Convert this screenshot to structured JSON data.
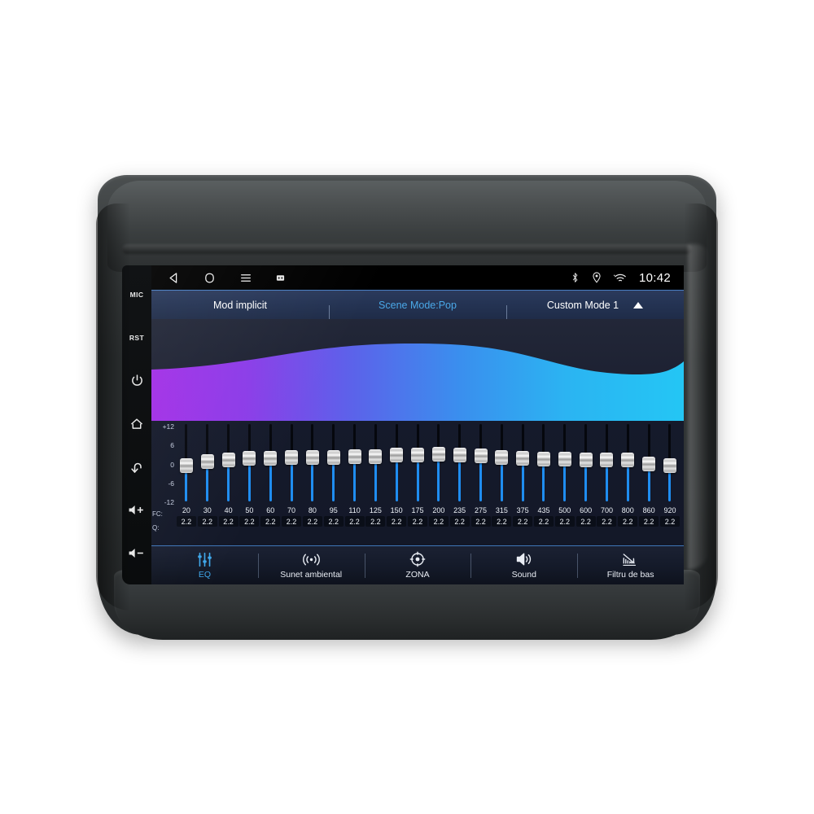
{
  "device": {
    "hardware_keys": [
      {
        "name": "mic",
        "label": "MIC",
        "icon": "mic-text"
      },
      {
        "name": "reset",
        "label": "RST",
        "icon": "reset-text"
      },
      {
        "name": "power",
        "label": "",
        "icon": "power-icon"
      },
      {
        "name": "home",
        "label": "",
        "icon": "home-icon"
      },
      {
        "name": "back",
        "label": "",
        "icon": "back-arrow-icon"
      },
      {
        "name": "volume-up",
        "label": "",
        "icon": "volume-up-icon"
      },
      {
        "name": "volume-down",
        "label": "",
        "icon": "volume-down-icon"
      }
    ]
  },
  "statusbar": {
    "nav": [
      "back-icon",
      "home-icon",
      "menu-icon",
      "screenshot-icon"
    ],
    "icons": [
      "bluetooth-icon",
      "location-icon",
      "wifi-icon"
    ],
    "clock": "10:42"
  },
  "modebar": {
    "default_mode": "Mod implicit",
    "scene_mode": "Scene Mode:Pop",
    "custom_mode": "Custom Mode 1",
    "expand_icon": "triangle-up-icon",
    "accent_color": "#4aa8e8"
  },
  "visualizer": {
    "gradient_start": "#9b3fe0",
    "gradient_end": "#27bdf0",
    "background": "#222738"
  },
  "eq": {
    "axis_labels": [
      "+12",
      "6",
      "0",
      "-6",
      "-12"
    ],
    "fc_row_label": "FC:",
    "q_row_label": "Q:",
    "fill_color": "#1f8df0",
    "bands": [
      {
        "fc": "20",
        "q": "2.2",
        "gain": -1.0
      },
      {
        "fc": "30",
        "q": "2.2",
        "gain": 0.3
      },
      {
        "fc": "40",
        "q": "2.2",
        "gain": 1.0
      },
      {
        "fc": "50",
        "q": "2.2",
        "gain": 1.4
      },
      {
        "fc": "60",
        "q": "2.2",
        "gain": 1.5
      },
      {
        "fc": "70",
        "q": "2.2",
        "gain": 1.6
      },
      {
        "fc": "80",
        "q": "2.2",
        "gain": 1.6
      },
      {
        "fc": "95",
        "q": "2.2",
        "gain": 1.7
      },
      {
        "fc": "110",
        "q": "2.2",
        "gain": 1.9
      },
      {
        "fc": "125",
        "q": "2.2",
        "gain": 2.0
      },
      {
        "fc": "150",
        "q": "2.2",
        "gain": 2.3
      },
      {
        "fc": "175",
        "q": "2.2",
        "gain": 2.3
      },
      {
        "fc": "200",
        "q": "2.2",
        "gain": 2.6
      },
      {
        "fc": "235",
        "q": "2.2",
        "gain": 2.4
      },
      {
        "fc": "275",
        "q": "2.2",
        "gain": 2.1
      },
      {
        "fc": "315",
        "q": "2.2",
        "gain": 1.7
      },
      {
        "fc": "375",
        "q": "2.2",
        "gain": 1.5
      },
      {
        "fc": "435",
        "q": "2.2",
        "gain": 1.2
      },
      {
        "fc": "500",
        "q": "2.2",
        "gain": 1.1
      },
      {
        "fc": "600",
        "q": "2.2",
        "gain": 0.9
      },
      {
        "fc": "700",
        "q": "2.2",
        "gain": 0.9
      },
      {
        "fc": "800",
        "q": "2.2",
        "gain": 0.8
      },
      {
        "fc": "860",
        "q": "2.2",
        "gain": -0.3
      },
      {
        "fc": "920",
        "q": "2.2",
        "gain": -1.0
      }
    ]
  },
  "toolbar": {
    "active_index": 0,
    "items": [
      {
        "label": "EQ",
        "icon": "equalizer-icon"
      },
      {
        "label": "Sunet ambiental",
        "icon": "surround-sound-icon"
      },
      {
        "label": "ZONA",
        "icon": "zone-target-icon"
      },
      {
        "label": "Sound",
        "icon": "speaker-icon"
      },
      {
        "label": "Filtru de bas",
        "icon": "bass-filter-icon"
      }
    ]
  }
}
